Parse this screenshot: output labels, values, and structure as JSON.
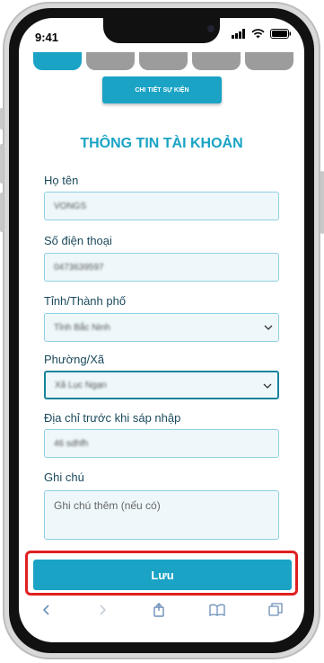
{
  "status_bar": {
    "time": "9:41"
  },
  "header": {
    "event_button_label": "CHI TIẾT SỰ KIỆN",
    "section_title": "THÔNG TIN TÀI KHOẢN"
  },
  "form": {
    "name": {
      "label": "Họ tên",
      "value": "VONGS"
    },
    "phone": {
      "label": "Số điện thoại",
      "value": "0473639597"
    },
    "province": {
      "label": "Tỉnh/Thành phố",
      "value": "Tỉnh Bắc Ninh"
    },
    "ward": {
      "label": "Phường/Xã",
      "value": "Xã Lục Ngạn"
    },
    "address": {
      "label": "Địa chỉ trước khi sáp nhập",
      "value": "46 sdhfh"
    },
    "note": {
      "label": "Ghi chú",
      "placeholder": "Ghi chú thêm (nếu có)"
    }
  },
  "actions": {
    "save_label": "Lưu"
  },
  "colors": {
    "accent": "#1aa3c4",
    "highlight": "#e02020"
  },
  "icons": [
    "signal-icon",
    "wifi-icon",
    "battery-icon",
    "back-icon",
    "forward-icon",
    "share-icon",
    "bookmarks-icon",
    "tabs-icon",
    "chevron-down-icon"
  ]
}
